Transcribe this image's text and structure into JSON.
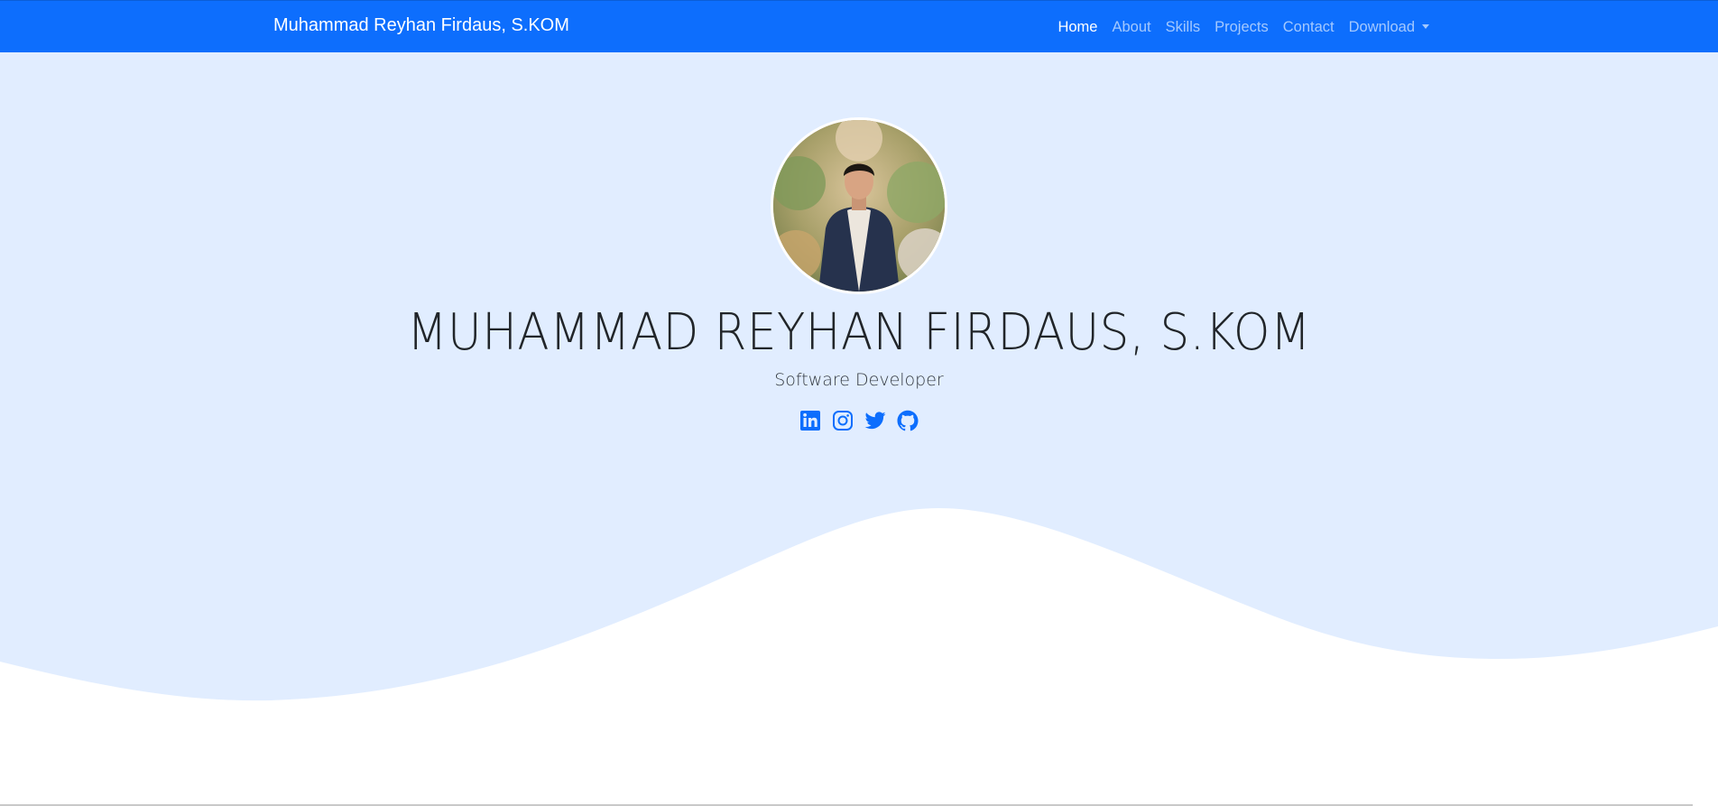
{
  "navbar": {
    "brand": "Muhammad Reyhan Firdaus, S.KOM",
    "links": [
      {
        "label": "Home",
        "active": true
      },
      {
        "label": "About"
      },
      {
        "label": "Skills"
      },
      {
        "label": "Projects"
      },
      {
        "label": "Contact"
      },
      {
        "label": "Download",
        "dropdown": true
      }
    ]
  },
  "hero": {
    "name": "MUHAMMAD REYHAN FIRDAUS, S.KOM",
    "role": "Software Developer",
    "socials": [
      {
        "icon": "linkedin-icon"
      },
      {
        "icon": "instagram-icon"
      },
      {
        "icon": "twitter-icon"
      },
      {
        "icon": "github-icon"
      }
    ]
  },
  "colors": {
    "navbar": "#0d6efd",
    "hero_background": "#e1edff",
    "wave": "#ffffff",
    "icon": "#0d6efd",
    "text": "#212529"
  }
}
